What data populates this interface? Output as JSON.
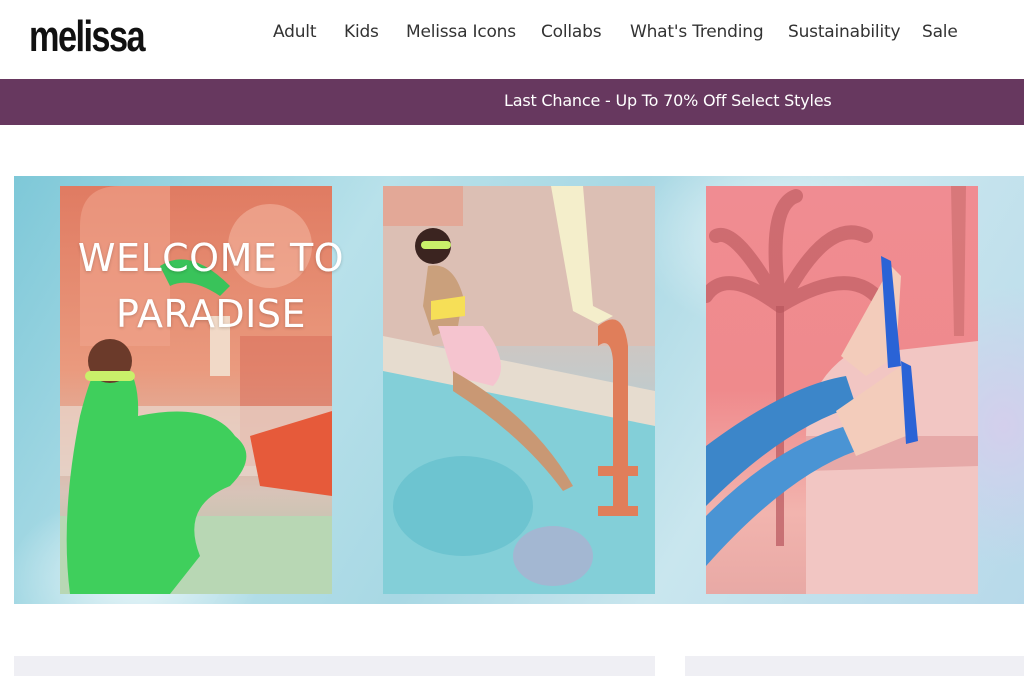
{
  "brand": {
    "logo_text": "melissa"
  },
  "nav": {
    "items": [
      {
        "label": "Adult"
      },
      {
        "label": "Kids"
      },
      {
        "label": "Melissa Icons"
      },
      {
        "label": "Collabs"
      },
      {
        "label": "What's Trending"
      },
      {
        "label": "Sustainability"
      },
      {
        "label": "Sale"
      }
    ]
  },
  "promo": {
    "text": "Last Chance - Up To 70% Off Select Styles",
    "color": "#67385f"
  },
  "hero": {
    "title_line1": "WELCOME TO",
    "title_line2": "PARADISE"
  }
}
